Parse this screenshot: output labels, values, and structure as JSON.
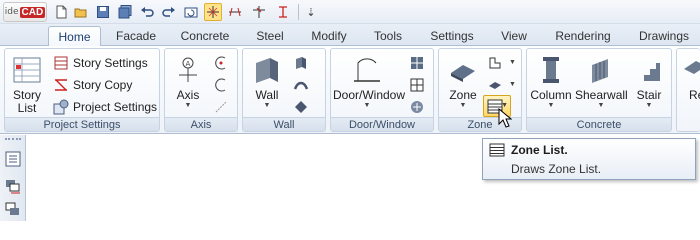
{
  "app": {
    "logo_prefix": "ide",
    "logo_main": "CAD"
  },
  "quick_access": {
    "icons": [
      "new-icon",
      "open-icon",
      "save-icon",
      "save-all-icon",
      "undo-icon",
      "redo-icon",
      "refresh-icon",
      "select-all-icon",
      "dimension-icon",
      "axis-snap-icon",
      "elevation-icon",
      "more-icon"
    ],
    "more_symbol": "⇣"
  },
  "tabs": [
    {
      "label": "Home",
      "active": true
    },
    {
      "label": "Facade"
    },
    {
      "label": "Concrete"
    },
    {
      "label": "Steel"
    },
    {
      "label": "Modify"
    },
    {
      "label": "Tools"
    },
    {
      "label": "Settings"
    },
    {
      "label": "View"
    },
    {
      "label": "Rendering"
    },
    {
      "label": "Drawings"
    }
  ],
  "ribbon": {
    "project_settings": {
      "label": "Project Settings",
      "story_list": "Story\nList",
      "story_settings": "Story Settings",
      "story_copy": "Story Copy",
      "project_settings_btn": "Project Settings"
    },
    "axis": {
      "label": "Axis",
      "axis_btn": "Axis"
    },
    "wall": {
      "label": "Wall",
      "wall_btn": "Wall"
    },
    "door_window": {
      "label": "Door/Window",
      "door_window_btn": "Door/Window"
    },
    "zone": {
      "label": "Zone",
      "zone_btn": "Zone"
    },
    "concrete": {
      "label": "Concrete",
      "column_btn": "Column",
      "shearwall_btn": "Shearwall",
      "stair_btn": "Stair",
      "cut_btn": "Re"
    }
  },
  "tooltip": {
    "title": "Zone List.",
    "description": "Draws Zone List."
  },
  "colors": {
    "accent": "#1c3f73",
    "highlight": "#ffd865",
    "logo_red": "#c62828"
  }
}
